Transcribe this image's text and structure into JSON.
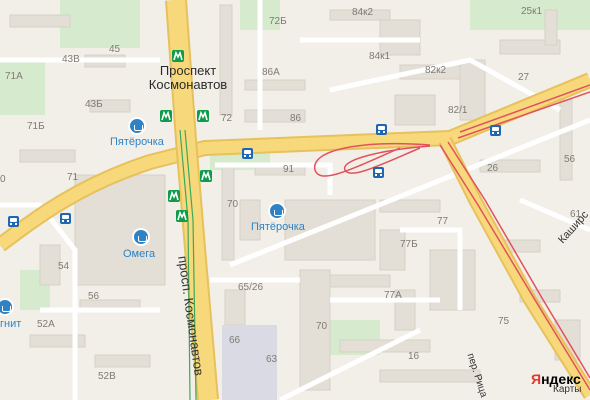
{
  "map": {
    "metro": {
      "name": "Проспект Космонавтов"
    },
    "streets": {
      "main_avenue": "просп. Космонавтов",
      "kashirskaya": "Каширс",
      "ritsa": "пер. Рица"
    },
    "pois": [
      {
        "name": "Пятёрочка",
        "type": "shop"
      },
      {
        "name": "Пятёрочка",
        "type": "shop"
      },
      {
        "name": "Омега",
        "type": "shop"
      },
      {
        "name": "гнит",
        "type": "shop"
      }
    ],
    "house_numbers": [
      "43В",
      "45",
      "71А",
      "43Б",
      "71Б",
      "71",
      "54",
      "56",
      "52А",
      "52В",
      "72Б",
      "86А",
      "72",
      "86",
      "91",
      "70",
      "65/26",
      "66",
      "63",
      "84к2",
      "84к1",
      "82к2",
      "82/1",
      "27",
      "25к1",
      "56",
      "26",
      "77",
      "77Б",
      "77А",
      "70",
      "75",
      "16",
      "61",
      "0"
    ],
    "colors": {
      "land": "#f2efe9",
      "building": "#e2ddd4",
      "green": "#cfe8c6",
      "road": "#ffffff",
      "major_road": "#f5cf6b",
      "rail": "#e0505a",
      "metro": "#0e9b4a",
      "bus": "#1f67b0",
      "poi": "#2f83c5"
    },
    "attribution": {
      "brand_red": "Я",
      "brand_rest": "ндекс",
      "brand_sub": "Карты"
    }
  }
}
